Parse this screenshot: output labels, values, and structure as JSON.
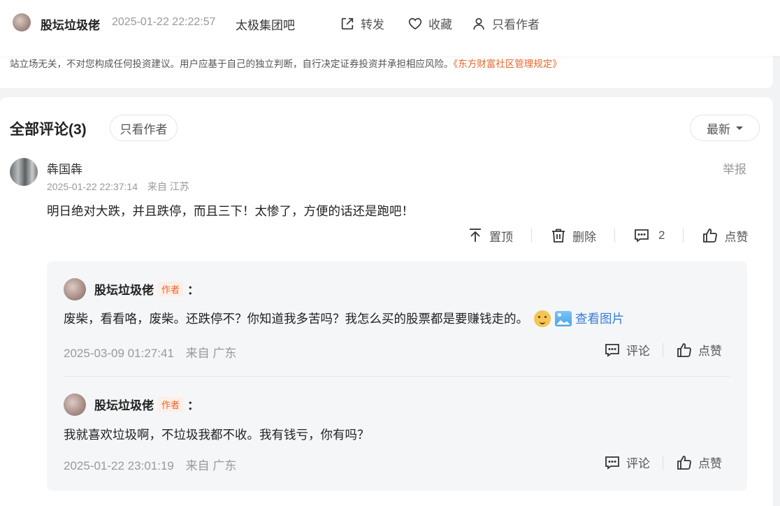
{
  "header": {
    "author": "股坛垃圾佬",
    "timestamp": "2025-01-22 22:22:57",
    "bar_name": "太极集团吧",
    "share_label": "转发",
    "favorite_label": "收藏",
    "author_only_label": "只看作者"
  },
  "disclaimer": {
    "text": "站立场无关，不对您构成任何投资建议。用户应基于自己的独立判断，自行决定证券投资并承担相应风险。",
    "link": "《东方财富社区管理规定》"
  },
  "comments": {
    "title": "全部评论(3)",
    "author_only_label": "只看作者",
    "sort_label": "最新",
    "main": {
      "username": "犇国犇",
      "timestamp": "2025-01-22 22:37:14",
      "location": "来自 江苏",
      "report_label": "举报",
      "text": "明日绝对大跌，并且跌停，而且三下！太惨了，方便的话还是跑吧！",
      "pin_label": "置顶",
      "delete_label": "删除",
      "reply_count": "2",
      "like_label": "点赞"
    },
    "replies": [
      {
        "username": "股坛垃圾佬",
        "tag": "作者",
        "colon": "：",
        "text": "废柴，看看咯，废柴。还跌停不？你知道我多苦吗？我怎么买的股票都是要赚钱走的。",
        "image_link": "查看图片",
        "timestamp": "2025-03-09 01:27:41",
        "location": "来自 广东",
        "comment_label": "评论",
        "like_label": "点赞"
      },
      {
        "username": "股坛垃圾佬",
        "tag": "作者",
        "colon": "：",
        "text": "我就喜欢垃圾啊，不垃圾我都不收。我有钱亏，你有吗？",
        "timestamp": "2025-01-22 23:01:19",
        "location": "来自 广东",
        "comment_label": "评论",
        "like_label": "点赞"
      }
    ]
  },
  "colors": {
    "accent_orange": "#e5662b",
    "link_blue": "#3a7bd5",
    "reply_bg": "#f4f6f8"
  }
}
